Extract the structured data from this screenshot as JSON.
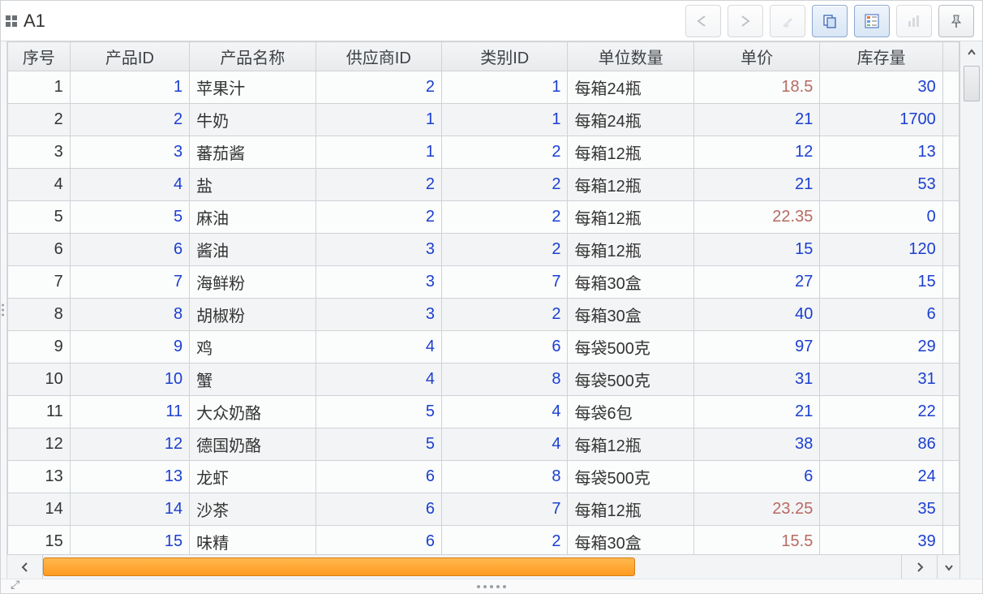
{
  "toolbar": {
    "cell_ref": "A1"
  },
  "columns": [
    {
      "key": "seq",
      "label": "序号"
    },
    {
      "key": "pid",
      "label": "产品ID"
    },
    {
      "key": "name",
      "label": "产品名称"
    },
    {
      "key": "sup",
      "label": "供应商ID"
    },
    {
      "key": "cat",
      "label": "类别ID"
    },
    {
      "key": "unit",
      "label": "单位数量"
    },
    {
      "key": "price",
      "label": "单价"
    },
    {
      "key": "stock",
      "label": "库存量"
    }
  ],
  "rows": [
    {
      "seq": 1,
      "pid": 1,
      "name": "苹果汁",
      "sup": 2,
      "cat": 1,
      "unit": "每箱24瓶",
      "price": "18.5",
      "stock": 30
    },
    {
      "seq": 2,
      "pid": 2,
      "name": "牛奶",
      "sup": 1,
      "cat": 1,
      "unit": "每箱24瓶",
      "price": "21",
      "stock": 1700
    },
    {
      "seq": 3,
      "pid": 3,
      "name": "蕃茄酱",
      "sup": 1,
      "cat": 2,
      "unit": "每箱12瓶",
      "price": "12",
      "stock": 13
    },
    {
      "seq": 4,
      "pid": 4,
      "name": "盐",
      "sup": 2,
      "cat": 2,
      "unit": "每箱12瓶",
      "price": "21",
      "stock": 53
    },
    {
      "seq": 5,
      "pid": 5,
      "name": "麻油",
      "sup": 2,
      "cat": 2,
      "unit": "每箱12瓶",
      "price": "22.35",
      "stock": 0
    },
    {
      "seq": 6,
      "pid": 6,
      "name": "酱油",
      "sup": 3,
      "cat": 2,
      "unit": "每箱12瓶",
      "price": "15",
      "stock": 120
    },
    {
      "seq": 7,
      "pid": 7,
      "name": "海鲜粉",
      "sup": 3,
      "cat": 7,
      "unit": "每箱30盒",
      "price": "27",
      "stock": 15
    },
    {
      "seq": 8,
      "pid": 8,
      "name": "胡椒粉",
      "sup": 3,
      "cat": 2,
      "unit": "每箱30盒",
      "price": "40",
      "stock": 6
    },
    {
      "seq": 9,
      "pid": 9,
      "name": "鸡",
      "sup": 4,
      "cat": 6,
      "unit": "每袋500克",
      "price": "97",
      "stock": 29
    },
    {
      "seq": 10,
      "pid": 10,
      "name": "蟹",
      "sup": 4,
      "cat": 8,
      "unit": "每袋500克",
      "price": "31",
      "stock": 31
    },
    {
      "seq": 11,
      "pid": 11,
      "name": "大众奶酪",
      "sup": 5,
      "cat": 4,
      "unit": "每袋6包",
      "price": "21",
      "stock": 22
    },
    {
      "seq": 12,
      "pid": 12,
      "name": "德国奶酪",
      "sup": 5,
      "cat": 4,
      "unit": "每箱12瓶",
      "price": "38",
      "stock": 86
    },
    {
      "seq": 13,
      "pid": 13,
      "name": "龙虾",
      "sup": 6,
      "cat": 8,
      "unit": "每袋500克",
      "price": "6",
      "stock": 24
    },
    {
      "seq": 14,
      "pid": 14,
      "name": "沙茶",
      "sup": 6,
      "cat": 7,
      "unit": "每箱12瓶",
      "price": "23.25",
      "stock": 35
    },
    {
      "seq": 15,
      "pid": 15,
      "name": "味精",
      "sup": 6,
      "cat": 2,
      "unit": "每箱30盒",
      "price": "15.5",
      "stock": 39
    }
  ]
}
